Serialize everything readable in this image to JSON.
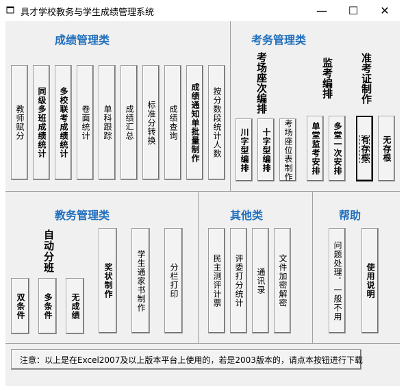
{
  "window": {
    "title": "具才学校教务与学生成绩管理系统",
    "minimize": "—",
    "maximize": "☐",
    "close": "✕"
  },
  "sections": {
    "grades": {
      "title": "成绩管理类",
      "buttons": [
        "教师赋分",
        "同级多班成绩统计",
        "多校联考成绩统计",
        "卷面统计",
        "单科跟踪",
        "成绩汇总",
        "标准分转换",
        "成绩查询",
        "成绩通知单批量制作",
        "按分数段统计人数"
      ]
    },
    "exam": {
      "title": "考务管理类",
      "group_seat": "考场座次编排",
      "group_proctor": "监考编排",
      "group_ticket": "准考证制作",
      "buttons": [
        "川字型编排",
        "十字型编排",
        "考场座位表制作",
        "单堂监考安排",
        "多堂一次安排",
        "有存根",
        "无存根"
      ]
    },
    "affairs": {
      "title": "教务管理类",
      "group_divide": "自动分班",
      "buttons": [
        "双条件",
        "多条件",
        "无成绩",
        "奖状制作",
        "学生通家书制作",
        "分栏打印"
      ]
    },
    "others": {
      "title": "其他类",
      "buttons": [
        "民主测评计票",
        "评委打分统计",
        "通讯录",
        "文件加密解密"
      ]
    },
    "help": {
      "title": "帮助",
      "buttons": [
        "问题处理．一般不用",
        "使用说明"
      ]
    }
  },
  "notice": "注意：以上是在Excel2007及以上版本平台上使用的，若是2003版本的，请点本按钮进行下载",
  "colors": {
    "section_title": "#1f6fbd",
    "background": "#f0f0f0"
  }
}
